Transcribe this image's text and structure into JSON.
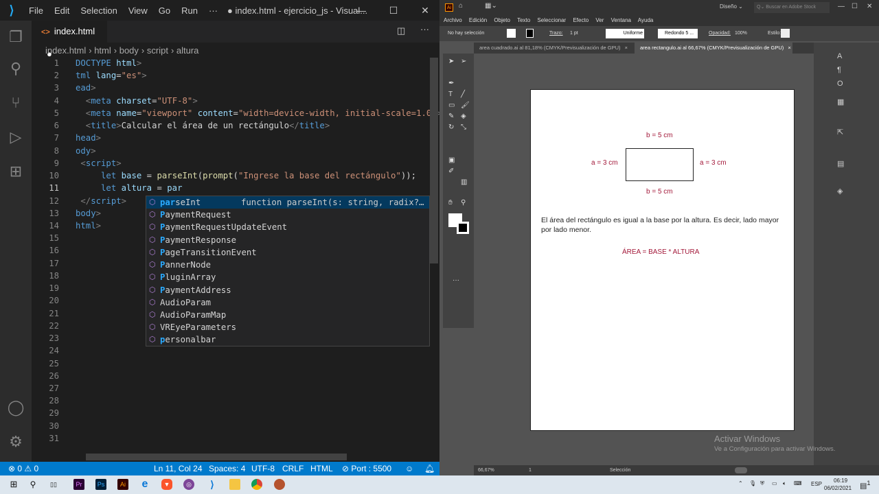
{
  "vscode": {
    "menu": [
      "File",
      "Edit",
      "Selection",
      "View",
      "Go",
      "Run",
      "···"
    ],
    "window_title": "● index.html - ejercicio_js - Visual...",
    "tab": {
      "label": "index.html",
      "modified": "●"
    },
    "breadcrumb": [
      "index.html",
      "html",
      "body",
      "script",
      "altura"
    ],
    "code_lines": [
      [
        [
          "DOCTYPE ",
          "t"
        ],
        [
          "html",
          "a"
        ],
        [
          ">",
          "p"
        ]
      ],
      [
        [
          "tml ",
          "t"
        ],
        [
          "lang",
          "a"
        ],
        [
          "=",
          "x"
        ],
        [
          "\"es\"",
          "s"
        ],
        [
          ">",
          "p"
        ]
      ],
      [
        [
          "ead",
          "t"
        ],
        [
          ">",
          "p"
        ]
      ],
      [
        [
          "  <",
          "p"
        ],
        [
          "meta ",
          "t"
        ],
        [
          "charset",
          "a"
        ],
        [
          "=",
          "x"
        ],
        [
          "\"UTF-8\"",
          "s"
        ],
        [
          ">",
          "p"
        ]
      ],
      [
        [
          "  <",
          "p"
        ],
        [
          "meta ",
          "t"
        ],
        [
          "name",
          "a"
        ],
        [
          "=",
          "x"
        ],
        [
          "\"viewport\" ",
          "s"
        ],
        [
          "content",
          "a"
        ],
        [
          "=",
          "x"
        ],
        [
          "\"width=device-width, initial-scale=1.0\"",
          "s"
        ],
        [
          ">",
          "p"
        ]
      ],
      [
        [
          "  <",
          "p"
        ],
        [
          "title",
          "t"
        ],
        [
          ">",
          "p"
        ],
        [
          "Calcular el área de un rectángulo",
          "x"
        ],
        [
          "</",
          "p"
        ],
        [
          "title",
          "t"
        ],
        [
          ">",
          "p"
        ]
      ],
      [
        [
          "head",
          "t"
        ],
        [
          ">",
          "p"
        ]
      ],
      [
        [
          "ody",
          "t"
        ],
        [
          ">",
          "p"
        ]
      ],
      [
        [
          " <",
          "p"
        ],
        [
          "script",
          "t"
        ],
        [
          ">",
          "p"
        ]
      ],
      [
        [
          "     let ",
          "kw"
        ],
        [
          "base ",
          "v"
        ],
        [
          "= ",
          "x"
        ],
        [
          "parseInt",
          "f"
        ],
        [
          "(",
          "x"
        ],
        [
          "prompt",
          "f"
        ],
        [
          "(",
          "x"
        ],
        [
          "\"Ingrese la base del rectángulo\"",
          "s"
        ],
        [
          "));",
          "x"
        ]
      ],
      [
        [
          "     let ",
          "kw"
        ],
        [
          "altura ",
          "v"
        ],
        [
          "= ",
          "x"
        ],
        [
          "par",
          "v"
        ]
      ],
      [
        [
          " </",
          "p"
        ],
        [
          "script",
          "t"
        ],
        [
          ">",
          "p"
        ]
      ],
      [
        [
          "body",
          "t"
        ],
        [
          ">",
          "p"
        ]
      ],
      [
        [
          "html",
          "t"
        ],
        [
          ">",
          "p"
        ]
      ]
    ],
    "total_lines": 31,
    "current_line": 11,
    "suggestions": [
      {
        "match": "par",
        "rest": "seInt",
        "detail": "function parseInt(s: string, radix?…"
      },
      {
        "match": "P",
        "rest": "aymentRequest"
      },
      {
        "match": "P",
        "rest": "aymentRequestUpdateEvent"
      },
      {
        "match": "P",
        "rest": "aymentResponse"
      },
      {
        "match": "P",
        "rest": "ageTransitionEvent"
      },
      {
        "match": "P",
        "rest": "annerNode"
      },
      {
        "match": "P",
        "rest": "luginArray"
      },
      {
        "match": "P",
        "rest": "aymentAddress"
      },
      {
        "match": "",
        "rest": "AudioParam"
      },
      {
        "match": "",
        "rest": "AudioParamMap"
      },
      {
        "match": "",
        "rest": "VREyeParameters"
      },
      {
        "match": "p",
        "rest": "ersonalbar"
      }
    ],
    "status": {
      "problems": "⊗ 0 ⚠ 0",
      "position": "Ln 11, Col 24",
      "spaces": "Spaces: 4",
      "encoding": "UTF-8",
      "eol": "CRLF",
      "language": "HTML",
      "port": "⊘ Port : 5500"
    }
  },
  "illustrator": {
    "workspace": "Diseño ⌄",
    "search_placeholder": "Q⌄ Buscar en Adobe Stock",
    "menu": [
      "Archivo",
      "Edición",
      "Objeto",
      "Texto",
      "Seleccionar",
      "Efecto",
      "Ver",
      "Ventana",
      "Ayuda"
    ],
    "control": {
      "selection": "No hay selección",
      "stroke_label": "Trazo:",
      "stroke_value": "1 pt",
      "profile": "Uniforme",
      "brush": "Redondo 5 ...",
      "opacity_label": "Opacidad:",
      "opacity": "100%",
      "style_label": "Estilo:"
    },
    "tabs": [
      {
        "label": "area cuadrado.ai al 81,18% (CMYK/Previsualización de GPU)",
        "close": "×"
      },
      {
        "label": "area rectangulo.ai al 66,67% (CMYK/Previsualización de GPU)",
        "close": "×"
      }
    ],
    "artboard": {
      "top_label": "b = 5 cm",
      "bottom_label": "b = 5 cm",
      "left_label": "a = 3 cm",
      "right_label": "a = 3 cm",
      "paragraph": "El área del rectángulo es igual a la base por la altura. Es decir, lado mayor por lado menor.",
      "formula": "ÁREA = BASE * ALTURA"
    },
    "status": {
      "zoom": "66,67%",
      "page": "1",
      "tool": "Selección"
    },
    "watermark": {
      "title": "Activar Windows",
      "subtitle": "Ve a Configuración para activar Windows."
    }
  },
  "taskbar": {
    "lang": "ESP",
    "time": "06:19",
    "date": "06/02/2021",
    "notifications": "1"
  }
}
